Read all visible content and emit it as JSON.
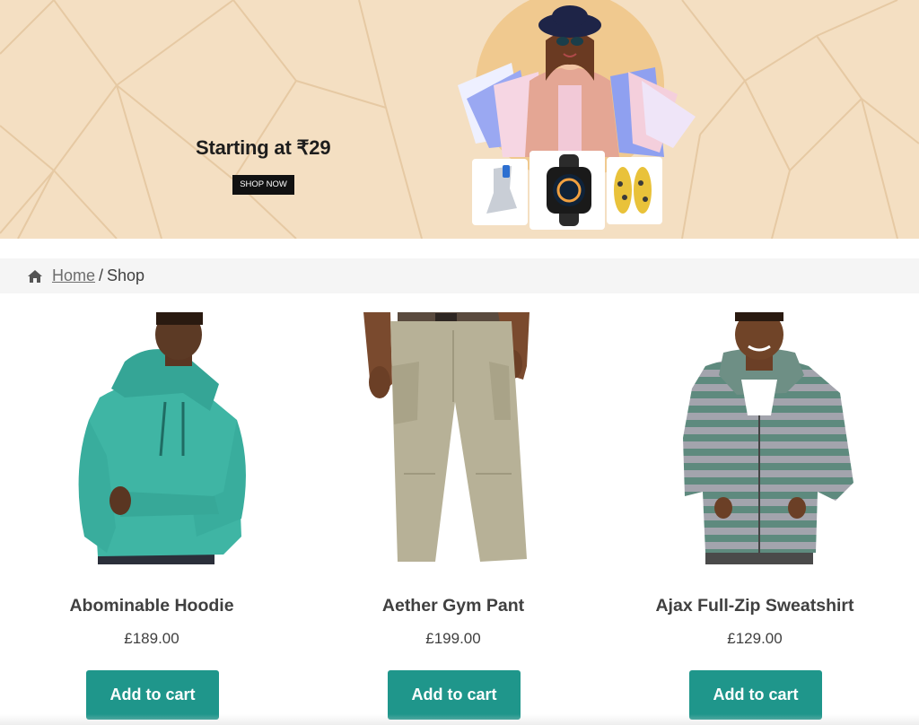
{
  "banner": {
    "headline": "Starting at ₹29",
    "cta_label": "SHOP NOW"
  },
  "breadcrumb": {
    "home_label": "Home",
    "separator": "/",
    "current": "Shop"
  },
  "products": [
    {
      "title": "Abominable Hoodie",
      "price": "£189.00",
      "button_label": "Add to cart"
    },
    {
      "title": "Aether Gym Pant",
      "price": "£199.00",
      "button_label": "Add to cart"
    },
    {
      "title": "Ajax Full-Zip Sweatshirt",
      "price": "£129.00",
      "button_label": "Add to cart"
    }
  ],
  "colors": {
    "banner_bg": "#f4dfc2",
    "accent_button": "#1f968b",
    "text": "#404040"
  }
}
